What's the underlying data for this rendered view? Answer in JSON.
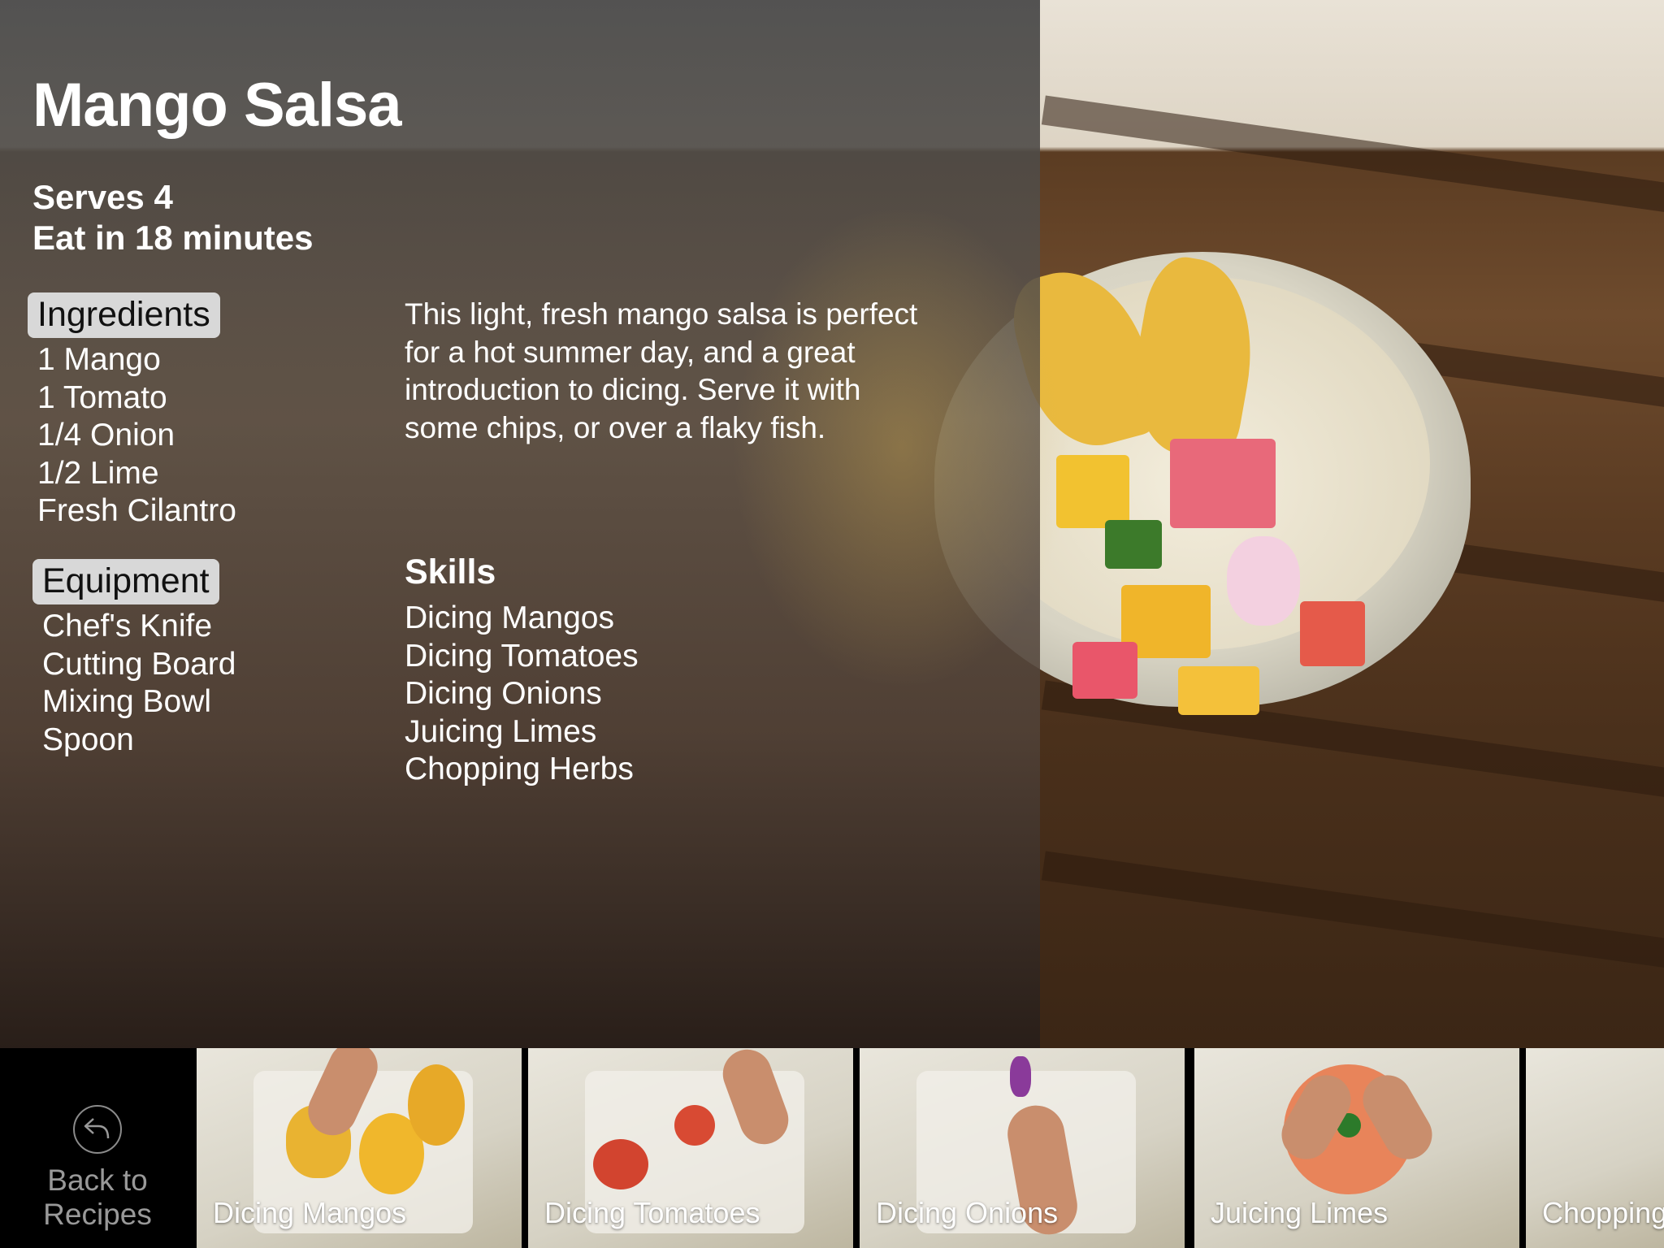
{
  "recipe": {
    "title": "Mango Salsa",
    "serves": "Serves 4",
    "time": "Eat in 18 minutes",
    "description": "This light, fresh mango salsa is perfect for a hot summer day, and a great introduction to dicing. Serve it with some chips, or over a flaky fish."
  },
  "ingredients": {
    "heading": "Ingredients",
    "items": [
      "1 Mango",
      "1 Tomato",
      "1/4 Onion",
      "1/2 Lime",
      "Fresh Cilantro"
    ]
  },
  "equipment": {
    "heading": "Equipment",
    "items": [
      "Chef's Knife",
      "Cutting Board",
      "Mixing Bowl",
      "Spoon"
    ]
  },
  "skills": {
    "heading": "Skills",
    "items": [
      "Dicing Mangos",
      "Dicing Tomatoes",
      "Dicing Onions",
      "Juicing Limes",
      "Chopping Herbs"
    ]
  },
  "bottom_bar": {
    "back_line1": "Back to",
    "back_line2": "Recipes",
    "back_icon": "reply-arrow-icon",
    "videos": [
      "Dicing Mangos",
      "Dicing Tomatoes",
      "Dicing Onions",
      "Juicing Limes",
      "Chopping"
    ]
  }
}
